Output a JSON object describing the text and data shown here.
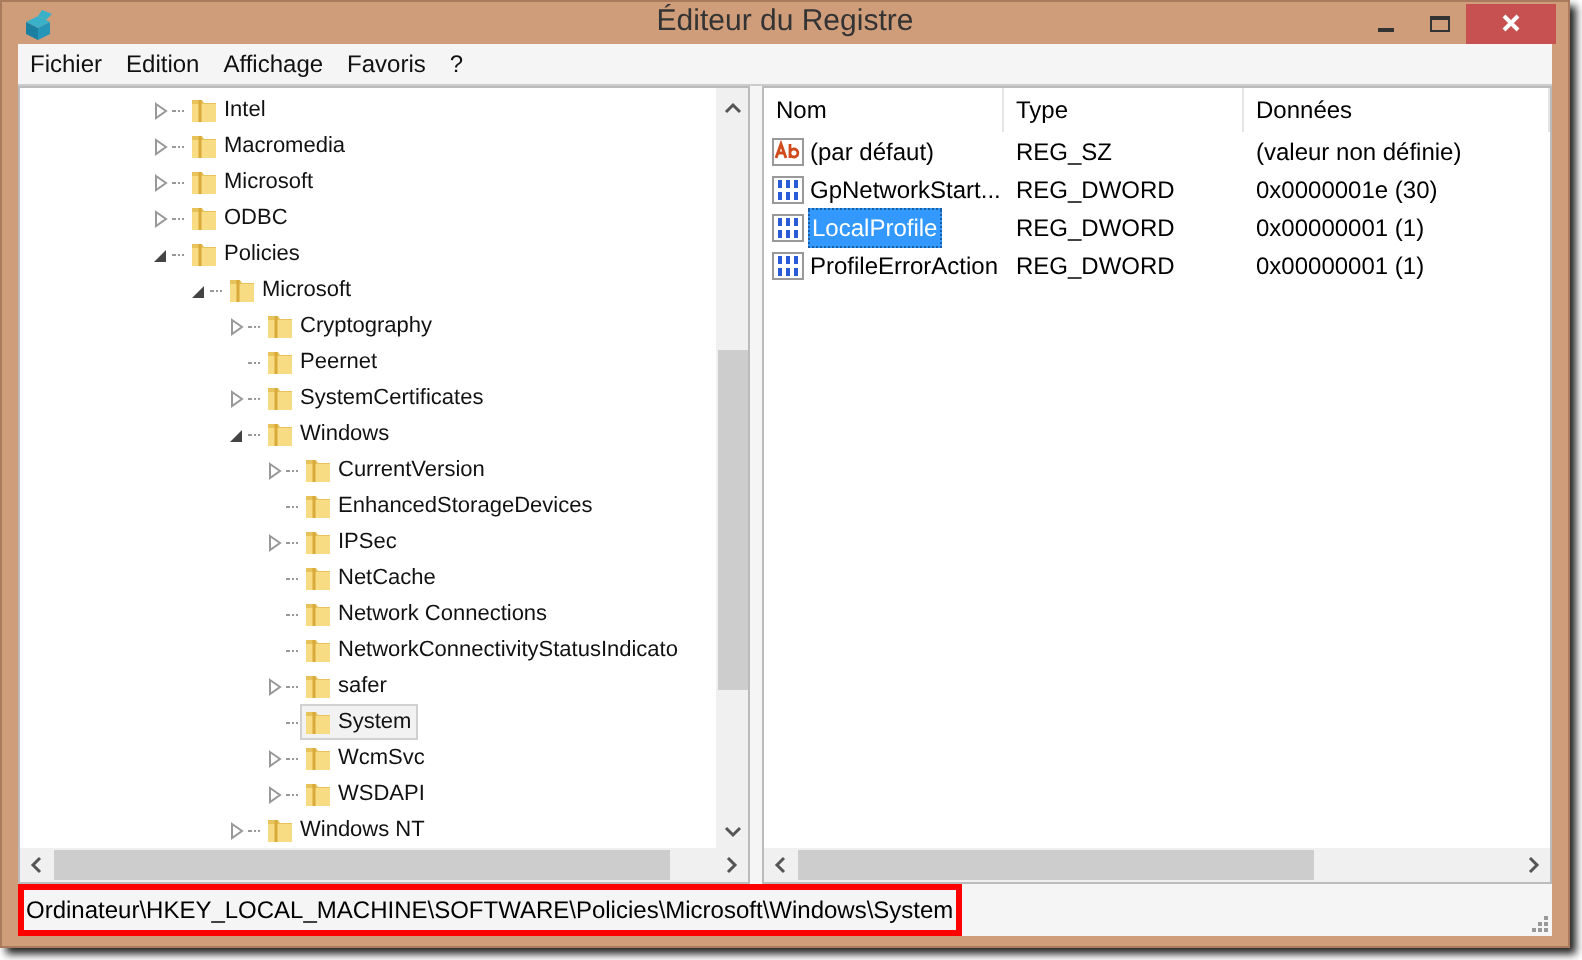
{
  "window": {
    "title": "Éditeur du Registre"
  },
  "menu": [
    {
      "label": "Fichier"
    },
    {
      "label": "Edition"
    },
    {
      "label": "Affichage"
    },
    {
      "label": "Favoris"
    },
    {
      "label": "?"
    }
  ],
  "tree": [
    {
      "label": "Intel",
      "expanded": false,
      "selected": false
    },
    {
      "label": "Macromedia",
      "expanded": false,
      "selected": false
    },
    {
      "label": "Microsoft",
      "expanded": false,
      "selected": false
    },
    {
      "label": "ODBC",
      "expanded": false,
      "selected": false
    },
    {
      "label": "Policies",
      "expanded": true,
      "selected": false,
      "children": [
        {
          "label": "Microsoft",
          "expanded": true,
          "selected": false,
          "children": [
            {
              "label": "Cryptography",
              "expanded": false,
              "selected": false
            },
            {
              "label": "Peernet",
              "selected": false
            },
            {
              "label": "SystemCertificates",
              "expanded": false,
              "selected": false
            },
            {
              "label": "Windows",
              "expanded": true,
              "selected": false,
              "children": [
                {
                  "label": "CurrentVersion",
                  "expanded": false,
                  "selected": false
                },
                {
                  "label": "EnhancedStorageDevices",
                  "selected": false
                },
                {
                  "label": "IPSec",
                  "expanded": false,
                  "selected": false
                },
                {
                  "label": "NetCache",
                  "selected": false
                },
                {
                  "label": "Network Connections",
                  "selected": false
                },
                {
                  "label": "NetworkConnectivityStatusIndicato",
                  "selected": false
                },
                {
                  "label": "safer",
                  "expanded": false,
                  "selected": false
                },
                {
                  "label": "System",
                  "selected": true
                },
                {
                  "label": "WcmSvc",
                  "expanded": false,
                  "selected": false
                },
                {
                  "label": "WSDAPI",
                  "expanded": false,
                  "selected": false
                }
              ]
            },
            {
              "label": "Windows NT",
              "expanded": false,
              "selected": false
            }
          ]
        }
      ]
    }
  ],
  "table": {
    "columns": [
      "Nom",
      "Type",
      "Données"
    ],
    "rows": [
      {
        "kind": "string",
        "name": "(par défaut)",
        "type": "REG_SZ",
        "data": "(valeur non définie)",
        "selected": false
      },
      {
        "kind": "binary",
        "name": "GpNetworkStart...",
        "type": "REG_DWORD",
        "data": "0x0000001e (30)",
        "selected": false
      },
      {
        "kind": "binary",
        "name": "LocalProfile",
        "type": "REG_DWORD",
        "data": "0x00000001 (1)",
        "selected": true
      },
      {
        "kind": "binary",
        "name": "ProfileErrorAction",
        "type": "REG_DWORD",
        "data": "0x00000001 (1)",
        "selected": false
      }
    ]
  },
  "status_bar": {
    "path": "Ordinateur\\HKEY_LOCAL_MACHINE\\SOFTWARE\\Policies\\Microsoft\\Windows\\System"
  }
}
